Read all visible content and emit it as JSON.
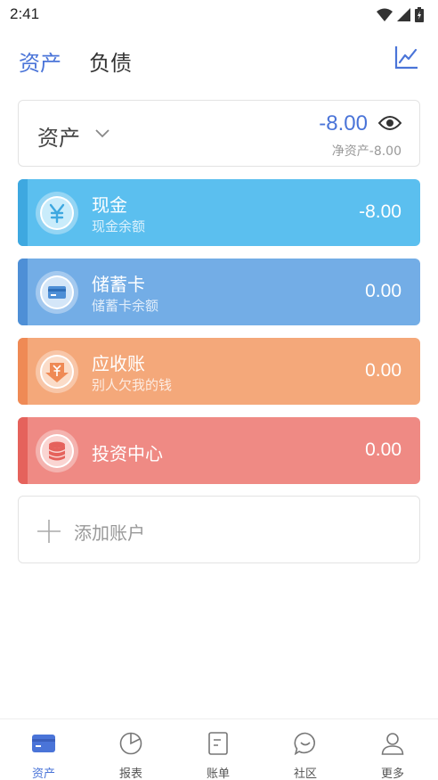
{
  "status_bar": {
    "time": "2:41"
  },
  "header": {
    "tabs": [
      {
        "label": "资产",
        "active": true
      },
      {
        "label": "负债",
        "active": false
      }
    ],
    "chart_icon": "trend-chart-icon"
  },
  "summary": {
    "title": "资产",
    "total": "-8.00",
    "net_label": "净资产-8.00"
  },
  "accounts": [
    {
      "name": "现金",
      "sub": "现金余额",
      "amount": "-8.00",
      "icon": "yuan-icon",
      "color": "#5bbfef",
      "stripe": "#3ea8e0"
    },
    {
      "name": "储蓄卡",
      "sub": "储蓄卡余额",
      "amount": "0.00",
      "icon": "bank-card-icon",
      "color": "#73ade6",
      "stripe": "#4e8fd6"
    },
    {
      "name": "应收账",
      "sub": "别人欠我的钱",
      "amount": "0.00",
      "icon": "receivable-icon",
      "color": "#f4a87a",
      "stripe": "#ef8a55"
    },
    {
      "name": "投资中心",
      "sub": "",
      "amount": "0.00",
      "icon": "coin-stack-icon",
      "color": "#ef8a84",
      "stripe": "#e5625c"
    }
  ],
  "add_account": {
    "label": "添加账户"
  },
  "bottom_nav": [
    {
      "label": "资产",
      "icon": "wallet-icon",
      "active": true
    },
    {
      "label": "报表",
      "icon": "pie-chart-icon",
      "active": false
    },
    {
      "label": "账单",
      "icon": "bill-icon",
      "active": false
    },
    {
      "label": "社区",
      "icon": "chat-icon",
      "active": false
    },
    {
      "label": "更多",
      "icon": "user-icon",
      "active": false
    }
  ],
  "colors": {
    "accent": "#4a74d8",
    "text": "#333333",
    "muted": "#999999"
  }
}
